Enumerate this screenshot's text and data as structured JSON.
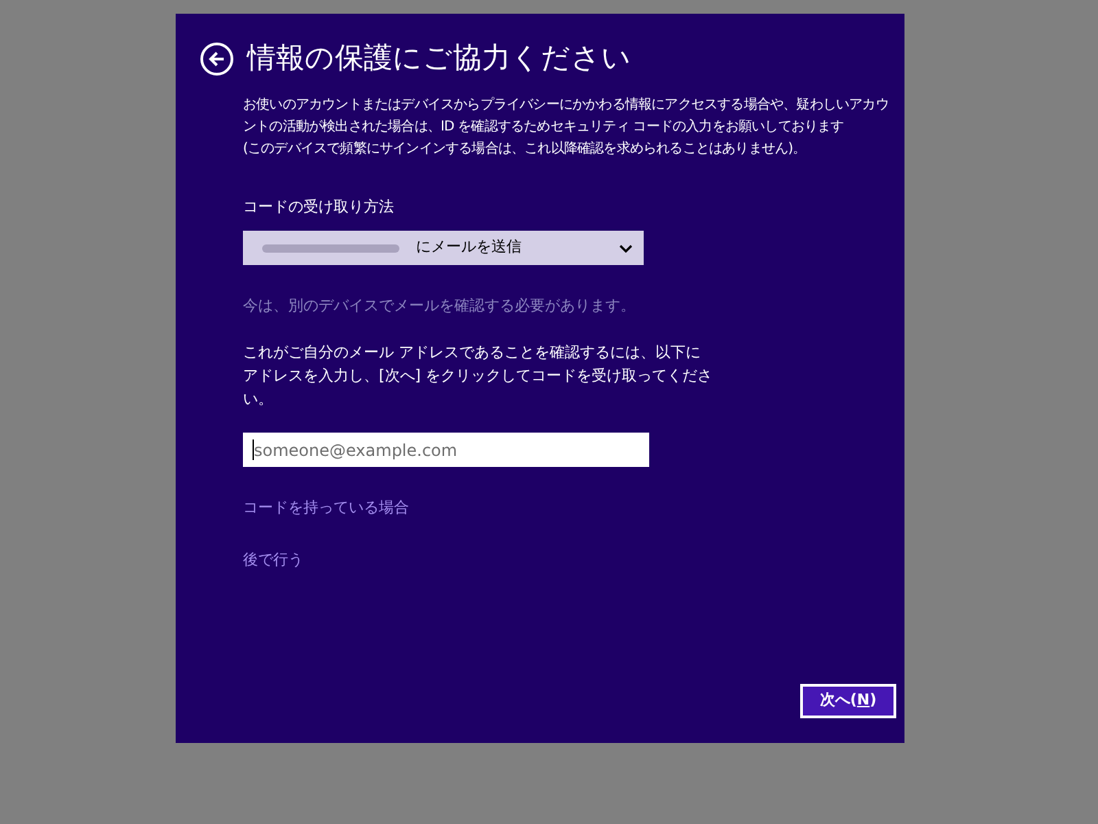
{
  "dialog": {
    "title": "情報の保護にご協力ください",
    "description_lines": [
      "お使いのアカウントまたはデバイスからプライバシーにかかわる情報にアクセスする場合や、疑わしいアカウ",
      "ントの活動が検出された場合は、ID を確認するためセキュリティ コードの入力をお願いしております",
      "(このデバイスで頻繁にサインインする場合は、これ以降確認を求められることはありません)。"
    ],
    "method_label": "コードの受け取り方法",
    "method_dropdown": {
      "value_redacted": true,
      "value_suffix": "にメールを送信"
    },
    "hint": "今は、別のデバイスでメールを確認する必要があります。",
    "instruction_lines": [
      "これがご自分のメール アドレスであることを確認するには、以下に",
      "アドレスを入力し、[次へ] をクリックしてコードを受け取ってくださ",
      "い。"
    ],
    "email_field": {
      "placeholder": "someone@example.com",
      "focused": true
    },
    "links": [
      "コードを持っている場合",
      "後で行う"
    ],
    "next_button": {
      "label_before": "次へ(",
      "access_key": "N",
      "label_after": ")"
    }
  }
}
